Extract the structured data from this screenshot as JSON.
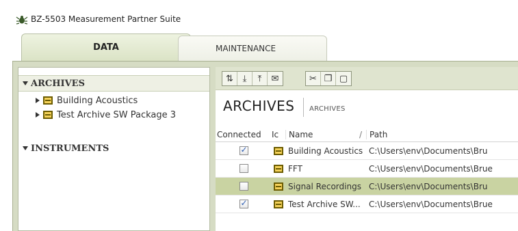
{
  "window": {
    "title": "BZ-5503 Measurement Partner Suite",
    "icon": "bug-app-icon"
  },
  "tabs": [
    {
      "label": "DATA",
      "active": true
    },
    {
      "label": "MAINTENANCE",
      "active": false
    }
  ],
  "nav": {
    "archives_header": "ARCHIVES",
    "archives": [
      {
        "label": "Building Acoustics",
        "icon": "archive-icon"
      },
      {
        "label": "Test Archive SW Package 3",
        "icon": "archive-icon"
      }
    ],
    "instruments_header": "INSTRUMENTS"
  },
  "toolbar": {
    "icons": [
      "sync-icon",
      "import-icon",
      "export-icon",
      "email-icon",
      "cut-icon",
      "copy-icon",
      "paste-icon"
    ]
  },
  "content": {
    "title": "ARCHIVES",
    "subtitle": "ARCHIVES"
  },
  "table": {
    "columns": {
      "connected": "Connected",
      "icon": "Ic",
      "name": "Name",
      "sort_mark": "/",
      "path": "Path"
    },
    "rows": [
      {
        "connected": true,
        "name": "Building Acoustics",
        "path": "C:\\Users\\env\\Documents\\Bru",
        "selected": false
      },
      {
        "connected": false,
        "name": "FFT",
        "path": "C:\\Users\\env\\Documents\\Brue",
        "selected": false
      },
      {
        "connected": false,
        "name": "Signal Recordings",
        "path": "C:\\Users\\env\\Documents\\Bru",
        "selected": true
      },
      {
        "connected": true,
        "name": "Test Archive SW...",
        "path": "C:\\Users\\env\\Documents\\Brue",
        "selected": false
      }
    ]
  },
  "colors": {
    "accent": "#c9d3a2",
    "panel": "#d6dcc4",
    "archive_icon": "#f5d25a"
  }
}
